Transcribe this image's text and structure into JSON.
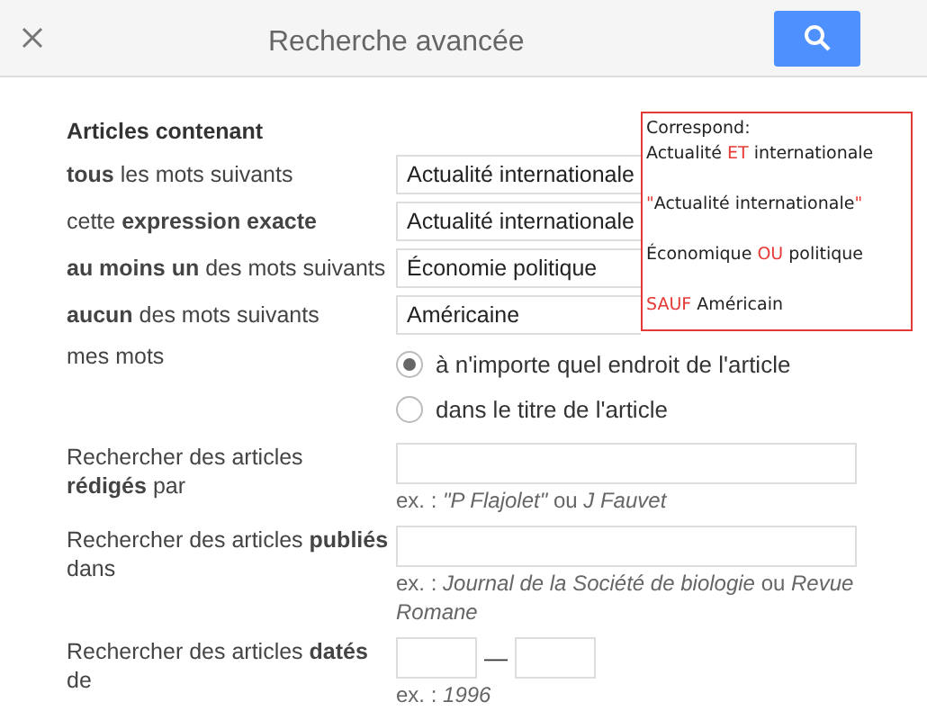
{
  "header": {
    "title": "Recherche avancée"
  },
  "section_title": "Articles contenant",
  "word_fields": [
    {
      "label": "**tous** les mots suivants",
      "value": "Actualité internationale"
    },
    {
      "label": "cette **expression exacte**",
      "value": "Actualité internationale"
    },
    {
      "label": "**au moins un** des mots suivants",
      "value": "Économie politique"
    },
    {
      "label": "**aucun** des mots suivants",
      "value": "Américaine"
    }
  ],
  "location": {
    "label": "mes mots",
    "options": [
      {
        "label": "à n'importe quel endroit de l'article",
        "selected": true
      },
      {
        "label": "dans le titre de l'article",
        "selected": false
      }
    ]
  },
  "author": {
    "label": "Rechercher des articles **rédigés** par",
    "hint": "ex. : *\"P Flajolet\"* ou *J Fauvet*"
  },
  "publication": {
    "label": "Rechercher des articles **publiés** dans",
    "hint": "ex. : *Journal de la Société de biologie* ou *Revue Romane*"
  },
  "date": {
    "label": "Rechercher des articles **datés** de",
    "separator": "—",
    "hint": "ex. : *1996*"
  },
  "annotation": {
    "heading": "Correspond:",
    "lines": [
      [
        {
          "text": "Actualité ",
          "kind": "plain"
        },
        {
          "text": "ET",
          "kind": "keyword"
        },
        {
          "text": " internationale",
          "kind": "plain"
        }
      ],
      [
        {
          "text": "\"",
          "kind": "keyword"
        },
        {
          "text": "Actualité internationale",
          "kind": "plain"
        },
        {
          "text": "\"",
          "kind": "keyword"
        }
      ],
      [
        {
          "text": "Économique ",
          "kind": "plain"
        },
        {
          "text": "OU",
          "kind": "keyword"
        },
        {
          "text": " politique",
          "kind": "plain"
        }
      ],
      [
        {
          "text": "SAUF",
          "kind": "keyword"
        },
        {
          "text": " Américain",
          "kind": "plain"
        }
      ]
    ]
  }
}
